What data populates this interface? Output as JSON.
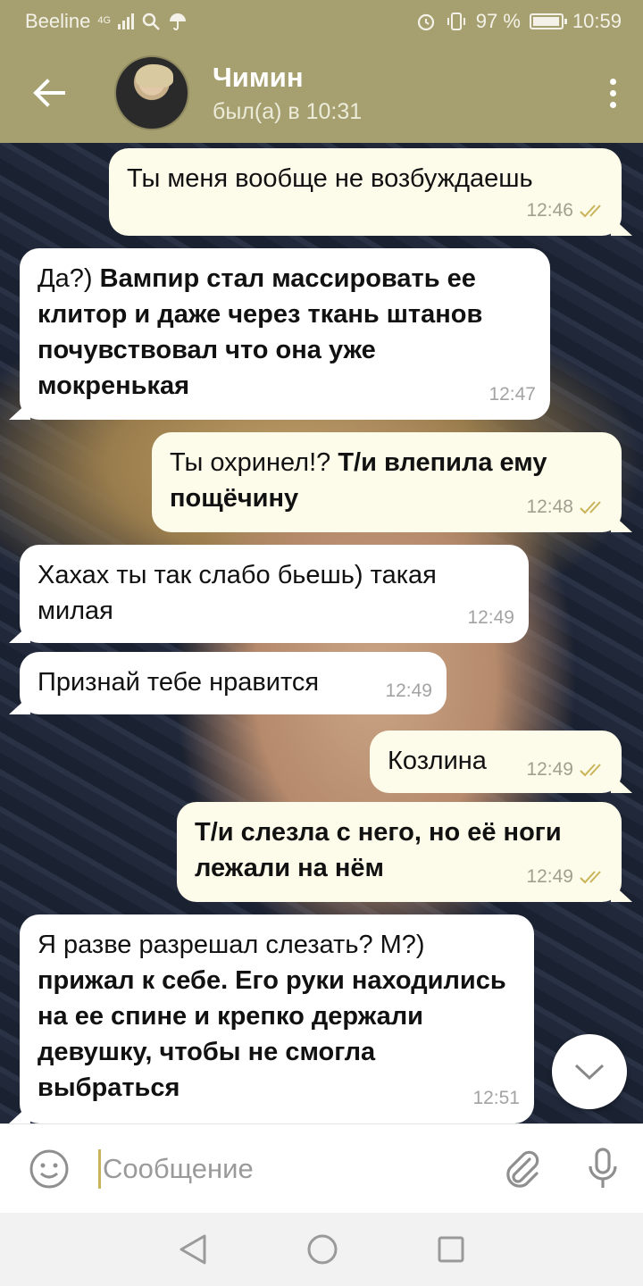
{
  "status_bar": {
    "carrier": "Beeline",
    "network": "4G",
    "battery_percent": "97 %",
    "battery_level": 0.97,
    "time": "10:59"
  },
  "header": {
    "contact_name": "Чимин",
    "last_seen": "был(а) в 10:31",
    "back_icon": "arrow-left-icon",
    "menu_icon": "more-vert-icon"
  },
  "messages": [
    {
      "dir": "out",
      "text": "Ты меня вообще не возбуждаешь",
      "bold": "",
      "time": "12:46",
      "read": true
    },
    {
      "dir": "in",
      "text": "Да?) ",
      "bold": "Вампир стал массировать ее клитор и даже через ткань штанов почувствовал что она уже мокренькая",
      "time": "12:47"
    },
    {
      "dir": "out",
      "text": "Ты охринел!? ",
      "bold": "Т/и влепила ему пощёчину",
      "time": "12:48",
      "read": true
    },
    {
      "dir": "in",
      "text": "Хахах ты так слабо бьешь) такая милая",
      "bold": "",
      "time": "12:49"
    },
    {
      "dir": "in",
      "text": "Признай тебе нравится",
      "bold": "",
      "time": "12:49"
    },
    {
      "dir": "out",
      "text": "Козлина",
      "bold": "",
      "time": "12:49",
      "read": true
    },
    {
      "dir": "out",
      "text": "",
      "bold": "Т/и слезла с него, но её ноги лежали на нём",
      "time": "12:49",
      "read": true
    },
    {
      "dir": "in",
      "text": "Я разве разрешал слезать? М?) ",
      "bold": "прижал к себе. Его руки находились на ее спине и крепко держали девушку, чтобы не смогла выбраться",
      "time": "12:51"
    }
  ],
  "input": {
    "placeholder": "Сообщение",
    "emoji_icon": "emoji-icon",
    "attach_icon": "paperclip-icon",
    "mic_icon": "microphone-icon"
  },
  "scroll_down_icon": "chevron-down-icon",
  "nav": [
    "back-triangle-icon",
    "home-circle-icon",
    "recents-square-icon"
  ],
  "colors": {
    "header": "#a6a070",
    "outgoing_bubble": "#fdfbe9",
    "incoming_bubble": "#ffffff",
    "tick": "#c9b45a"
  }
}
